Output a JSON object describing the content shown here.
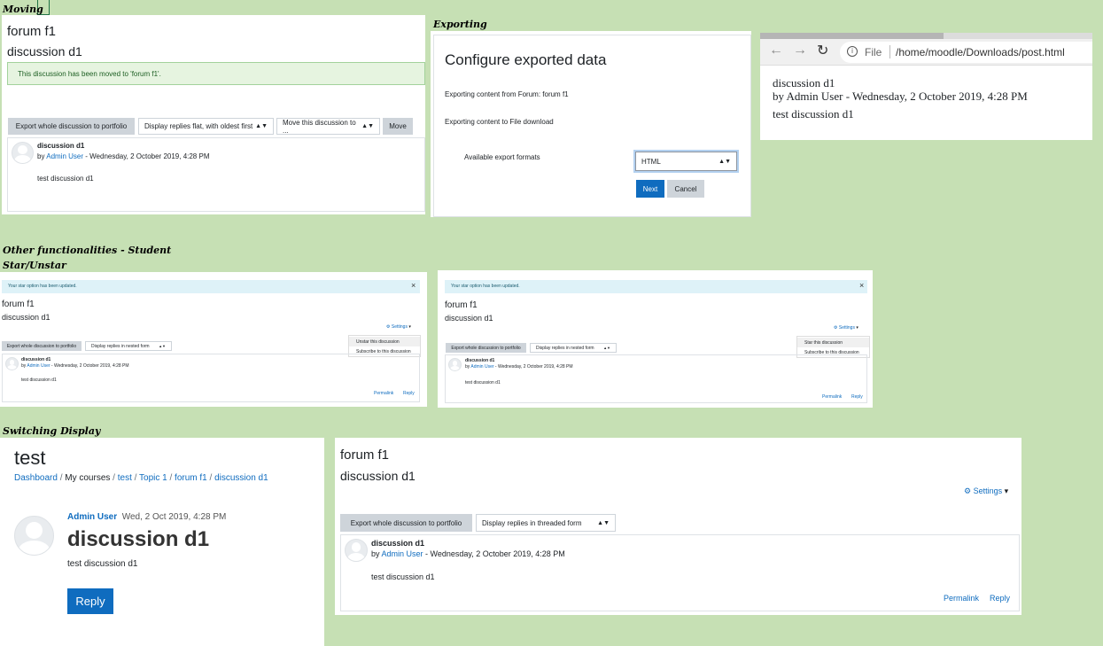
{
  "labels": {
    "moving": "Moving",
    "exporting": "Exporting",
    "other": "Other functionalities - Student",
    "star": "Star/Unstar",
    "switching": "Switching Display"
  },
  "moving": {
    "forum": "forum f1",
    "discussion": "discussion d1",
    "alert": "This discussion has been moved to 'forum f1'.",
    "export_btn": "Export whole discussion to portfolio",
    "display_select": "Display replies flat, with oldest first",
    "move_select": "Move this discussion to ...",
    "move_btn": "Move",
    "post_title": "discussion d1",
    "by": "by ",
    "author": "Admin User",
    "date": " - Wednesday, 2 October 2019, 4:28 PM",
    "body": "test discussion d1"
  },
  "export": {
    "title": "Configure exported data",
    "from": "Exporting content from Forum: forum f1",
    "to": "Exporting content to File download",
    "formats_label": "Available export formats",
    "format_value": "HTML",
    "next": "Next",
    "cancel": "Cancel"
  },
  "browser": {
    "file_label": "File",
    "url": "/home/moodle/Downloads/post.html",
    "title": "discussion d1",
    "byline": "by Admin User - Wednesday, 2 October 2019, 4:28 PM",
    "body": "test discussion d1"
  },
  "star1": {
    "alert": "Your star option has been updated.",
    "close": "×",
    "forum": "forum f1",
    "discussion": "discussion d1",
    "settings": "Settings",
    "menu": [
      "Unstar this discussion",
      "Subscribe to this discussion"
    ],
    "export_btn": "Export whole discussion to portfolio",
    "display_select": "Display replies in nested form",
    "post_title": "discussion d1",
    "by": "by ",
    "author": "Admin User",
    "date": " - Wednesday, 2 October 2019, 4:28 PM",
    "body": "test discussion d1",
    "permalink": "Permalink",
    "reply": "Reply"
  },
  "star2": {
    "alert": "Your star option has been updated.",
    "close": "×",
    "forum": "forum f1",
    "discussion": "discussion d1",
    "settings": "Settings",
    "menu": [
      "Star this discussion",
      "Subscribe to this discussion"
    ],
    "export_btn": "Export whole discussion to portfolio",
    "display_select": "Display replies in nested form",
    "post_title": "discussion d1",
    "by": "by ",
    "author": "Admin User",
    "date": " - Wednesday, 2 October 2019, 4:28 PM",
    "body": "test discussion d1",
    "permalink": "Permalink",
    "reply": "Reply"
  },
  "switch1": {
    "course": "test",
    "breadcrumb": [
      "Dashboard",
      "My courses",
      "test",
      "Topic 1",
      "forum f1",
      "discussion d1"
    ],
    "author": "Admin User",
    "date": "Wed, 2 Oct 2019, 4:28 PM",
    "title": "discussion d1",
    "body": "test discussion d1",
    "reply": "Reply"
  },
  "switch2": {
    "forum": "forum f1",
    "discussion": "discussion d1",
    "settings": "Settings",
    "export_btn": "Export whole discussion to portfolio",
    "display_select": "Display replies in threaded form",
    "post_title": "discussion d1",
    "by": "by ",
    "author": "Admin User",
    "date": " - Wednesday, 2 October 2019, 4:28 PM",
    "body": "test discussion d1",
    "permalink": "Permalink",
    "reply": "Reply"
  },
  "colors": {
    "background": "#c6e0b4",
    "primary": "#0f6cbf",
    "success_bg": "#e6f4e0",
    "info_bg": "#def2f8"
  }
}
